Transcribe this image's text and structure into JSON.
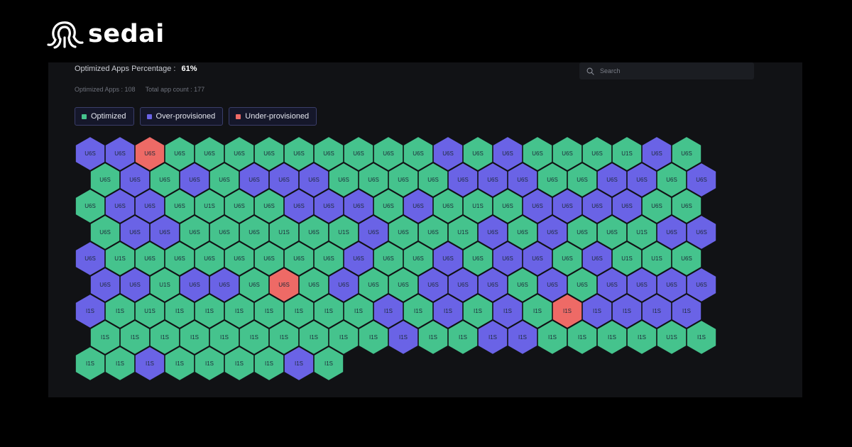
{
  "brand": {
    "name": "sedai"
  },
  "summary": {
    "percentage_label": "Optimized Apps Percentage :",
    "percentage_value": "61%",
    "optimized_apps": "Optimized Apps : 108",
    "total_app_count": "Total app count : 177"
  },
  "search": {
    "placeholder": "Search"
  },
  "legend": [
    {
      "label": "Optimized",
      "status": "optimized"
    },
    {
      "label": "Over-provisioned",
      "status": "over"
    },
    {
      "label": "Under-provisioned",
      "status": "under"
    }
  ],
  "colors": {
    "optimized": "#45c38d",
    "over": "#6a63e6",
    "under": "#ee6a66",
    "background": "#000000",
    "panel": "#111215"
  },
  "hex_rows": [
    {
      "labels": [
        "U6S",
        "U6S",
        "U6S",
        "U6S",
        "U6S",
        "U6S",
        "U6S",
        "U6S",
        "U6S",
        "U6S",
        "U6S",
        "U6S",
        "U6S",
        "U6S",
        "U6S",
        "U6S",
        "U6S",
        "U6S",
        "U1S",
        "U6S",
        "U6S"
      ],
      "status": [
        "O",
        "O",
        "U",
        "G",
        "G",
        "G",
        "G",
        "G",
        "G",
        "G",
        "G",
        "G",
        "O",
        "G",
        "O",
        "G",
        "G",
        "G",
        "G",
        "O",
        "G"
      ]
    },
    {
      "labels": [
        "U6S",
        "U6S",
        "U6S",
        "U6S",
        "U6S",
        "U6S",
        "U6S",
        "U6S",
        "U6S",
        "U6S",
        "U6S",
        "U6S",
        "U6S",
        "U6S",
        "U6S",
        "U6S",
        "U6S",
        "U6S",
        "U6S",
        "U6S",
        "U6S",
        "U6S"
      ],
      "status": [
        "G",
        "O",
        "G",
        "O",
        "G",
        "O",
        "O",
        "O",
        "G",
        "G",
        "G",
        "G",
        "O",
        "O",
        "O",
        "G",
        "G",
        "O",
        "O",
        "G",
        "O"
      ]
    },
    {
      "labels": [
        "U6S",
        "U6S",
        "U6S",
        "U6S",
        "U1S",
        "U6S",
        "U6S",
        "U6S",
        "U6S",
        "U6S",
        "U6S",
        "U6S",
        "U6S",
        "U1S",
        "U6S",
        "U6S",
        "U6S",
        "U6S",
        "U6S",
        "U6S",
        "U6S"
      ],
      "status": [
        "G",
        "O",
        "O",
        "G",
        "G",
        "G",
        "G",
        "O",
        "O",
        "O",
        "G",
        "O",
        "G",
        "G",
        "G",
        "O",
        "O",
        "O",
        "O",
        "G",
        "G"
      ]
    },
    {
      "labels": [
        "U6S",
        "U6S",
        "U6S",
        "U6S",
        "U6S",
        "U6S",
        "U1S",
        "U6S",
        "U1S",
        "U6S",
        "U6S",
        "U6S",
        "U1S",
        "U6S",
        "U6S",
        "U6S",
        "U6S",
        "U6S",
        "U1S",
        "U6S",
        "U6S"
      ],
      "status": [
        "G",
        "O",
        "O",
        "G",
        "G",
        "G",
        "G",
        "G",
        "G",
        "O",
        "G",
        "G",
        "G",
        "O",
        "G",
        "O",
        "G",
        "G",
        "G",
        "O",
        "O"
      ]
    },
    {
      "labels": [
        "U6S",
        "U1S",
        "U6S",
        "U6S",
        "U6S",
        "U6S",
        "U6S",
        "U6S",
        "U6S",
        "U6S",
        "U6S",
        "U6S",
        "U6S",
        "U6S",
        "U6S",
        "U6S",
        "U6S",
        "U6S",
        "U1S",
        "U1S",
        "U6S"
      ],
      "status": [
        "O",
        "G",
        "G",
        "G",
        "G",
        "G",
        "G",
        "G",
        "G",
        "O",
        "G",
        "G",
        "O",
        "G",
        "O",
        "O",
        "G",
        "O",
        "G",
        "G",
        "G"
      ]
    },
    {
      "labels": [
        "U6S",
        "U6S",
        "U1S",
        "U6S",
        "U6S",
        "U6S",
        "U6S",
        "U6S",
        "U6S",
        "U6S",
        "U6S",
        "U6S",
        "U6S",
        "U6S",
        "U6S",
        "U6S",
        "U6S",
        "U6S",
        "U6S",
        "U6S",
        "U6S",
        "U6S"
      ],
      "status": [
        "O",
        "O",
        "G",
        "O",
        "O",
        "G",
        "U",
        "G",
        "O",
        "G",
        "G",
        "O",
        "O",
        "O",
        "G",
        "O",
        "G",
        "O",
        "O",
        "O",
        "O"
      ]
    },
    {
      "labels": [
        "I1S",
        "I1S",
        "U1S",
        "I1S",
        "I1S",
        "I1S",
        "I1S",
        "I1S",
        "I1S",
        "I1S",
        "I1S",
        "I1S",
        "I1S",
        "I1S",
        "I1S",
        "I1S",
        "I1S",
        "I1S",
        "I1S",
        "I1S",
        "I1S"
      ],
      "status": [
        "O",
        "G",
        "G",
        "G",
        "G",
        "G",
        "G",
        "G",
        "G",
        "G",
        "O",
        "G",
        "O",
        "G",
        "O",
        "G",
        "U",
        "O",
        "O",
        "O",
        "O"
      ]
    },
    {
      "labels": [
        "I1S",
        "I1S",
        "I1S",
        "I1S",
        "I1S",
        "I1S",
        "I1S",
        "I1S",
        "I1S",
        "I1S",
        "I1S",
        "I1S",
        "I1S",
        "I1S",
        "I1S",
        "I1S",
        "I1S",
        "I1S",
        "I1S",
        "U1S",
        "I1S",
        "I1S"
      ],
      "status": [
        "G",
        "G",
        "G",
        "G",
        "G",
        "G",
        "G",
        "G",
        "G",
        "G",
        "O",
        "G",
        "G",
        "O",
        "O",
        "G",
        "G",
        "G",
        "G",
        "G",
        "G"
      ]
    },
    {
      "labels": [
        "I1S",
        "I1S",
        "I1S",
        "I1S",
        "I1S",
        "I1S",
        "I1S",
        "I1S",
        "I1S"
      ],
      "status": [
        "G",
        "G",
        "O",
        "G",
        "G",
        "G",
        "G",
        "O",
        "G"
      ]
    }
  ]
}
